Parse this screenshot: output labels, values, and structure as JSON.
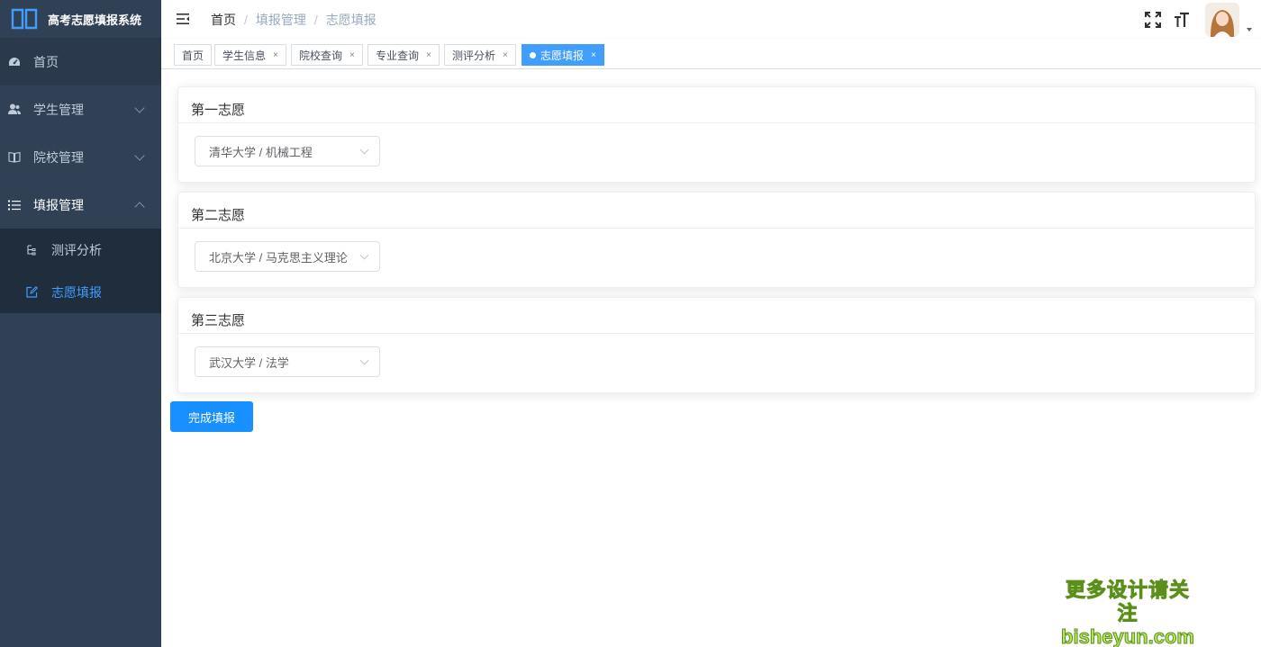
{
  "app": {
    "title": "高考志愿填报系统"
  },
  "colors": {
    "sidebar_bg": "#304156",
    "accent": "#409eff",
    "button": "#1890ff"
  },
  "sidebar": {
    "items": [
      {
        "label": "首页",
        "icon": "dashboard-icon"
      },
      {
        "label": "学生管理",
        "icon": "user-icon"
      },
      {
        "label": "院校管理",
        "icon": "book-icon"
      },
      {
        "label": "填报管理",
        "icon": "list-icon"
      }
    ],
    "submenu": [
      {
        "label": "测评分析",
        "icon": "tree-icon",
        "active": false
      },
      {
        "label": "志愿填报",
        "icon": "edit-icon",
        "active": true
      }
    ]
  },
  "breadcrumb": [
    "首页",
    "填报管理",
    "志愿填报"
  ],
  "tags": [
    {
      "label": "首页",
      "closable": false
    },
    {
      "label": "学生信息",
      "closable": true
    },
    {
      "label": "院校查询",
      "closable": true
    },
    {
      "label": "专业查询",
      "closable": true
    },
    {
      "label": "测评分析",
      "closable": true
    },
    {
      "label": "志愿填报",
      "closable": true,
      "active": true
    }
  ],
  "tag_close": "×",
  "choices": [
    {
      "title": "第一志愿",
      "value": "清华大学 / 机械工程"
    },
    {
      "title": "第二志愿",
      "value": "北京大学 / 马克思主义理论"
    },
    {
      "title": "第三志愿",
      "value": "武汉大学 / 法学"
    }
  ],
  "submit_label": "完成填报",
  "watermark": {
    "line1": "更多设计请关注",
    "line2": "bisheyun.com"
  }
}
